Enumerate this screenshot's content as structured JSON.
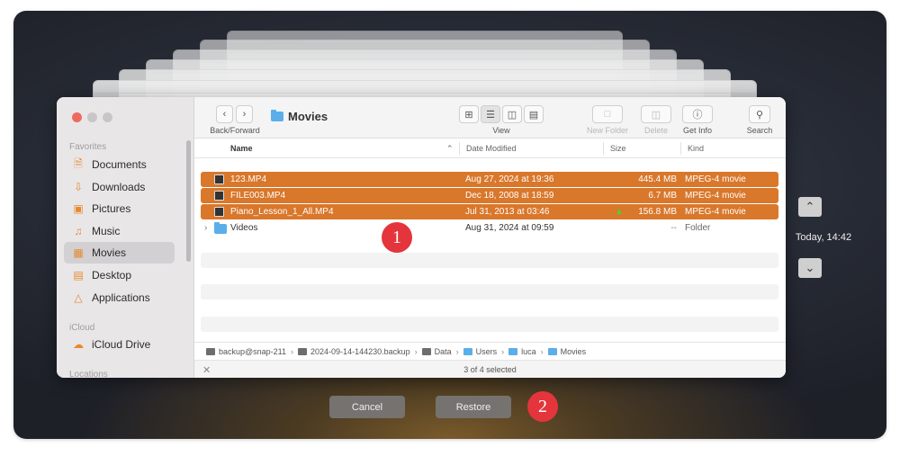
{
  "window": {
    "title": "Movies",
    "sidebar": {
      "favorites_heading": "Favorites",
      "items": [
        {
          "label": "Documents",
          "icon": "document-icon"
        },
        {
          "label": "Downloads",
          "icon": "download-icon"
        },
        {
          "label": "Pictures",
          "icon": "pictures-icon"
        },
        {
          "label": "Music",
          "icon": "music-icon"
        },
        {
          "label": "Movies",
          "icon": "movies-icon",
          "active": true
        },
        {
          "label": "Desktop",
          "icon": "desktop-icon"
        },
        {
          "label": "Applications",
          "icon": "applications-icon"
        }
      ],
      "icloud_heading": "iCloud",
      "icloud_items": [
        {
          "label": "iCloud Drive",
          "icon": "cloud-icon"
        }
      ],
      "locations_heading": "Locations"
    },
    "toolbar": {
      "back_forward_label": "Back/Forward",
      "view_label": "View",
      "new_folder_label": "New Folder",
      "delete_label": "Delete",
      "get_info_label": "Get Info",
      "search_label": "Search"
    },
    "columns": {
      "name": "Name",
      "date_modified": "Date Modified",
      "size": "Size",
      "kind": "Kind"
    },
    "files": [
      {
        "name": "123.MP4",
        "date": "Aug 27, 2024 at 19:36",
        "size": "445.4 MB",
        "kind": "MPEG-4 movie",
        "selected": true
      },
      {
        "name": "FILE003.MP4",
        "date": "Dec 18, 2008 at 18:59",
        "size": "6.7 MB",
        "kind": "MPEG-4 movie",
        "selected": true
      },
      {
        "name": "Piano_Lesson_1_All.MP4",
        "date": "Jul 31, 2013 at 03:46",
        "size": "156.8 MB",
        "kind": "MPEG-4 movie",
        "selected": true
      },
      {
        "name": "Videos",
        "date": "Aug 31, 2024 at 09:59",
        "size": "--",
        "kind": "Folder",
        "selected": false
      }
    ],
    "path": [
      "backup@snap-211",
      "2024-09-14-144230.backup",
      "Data",
      "Users",
      "luca",
      "Movies"
    ],
    "status": "3 of 4 selected"
  },
  "actions": {
    "cancel": "Cancel",
    "restore": "Restore"
  },
  "timeline": {
    "label": "Today, 14:42"
  },
  "annotations": {
    "one": "1",
    "two": "2"
  },
  "colors": {
    "selection": "#d9772b",
    "badge": "#e3353b",
    "folder": "#5aaeea"
  }
}
